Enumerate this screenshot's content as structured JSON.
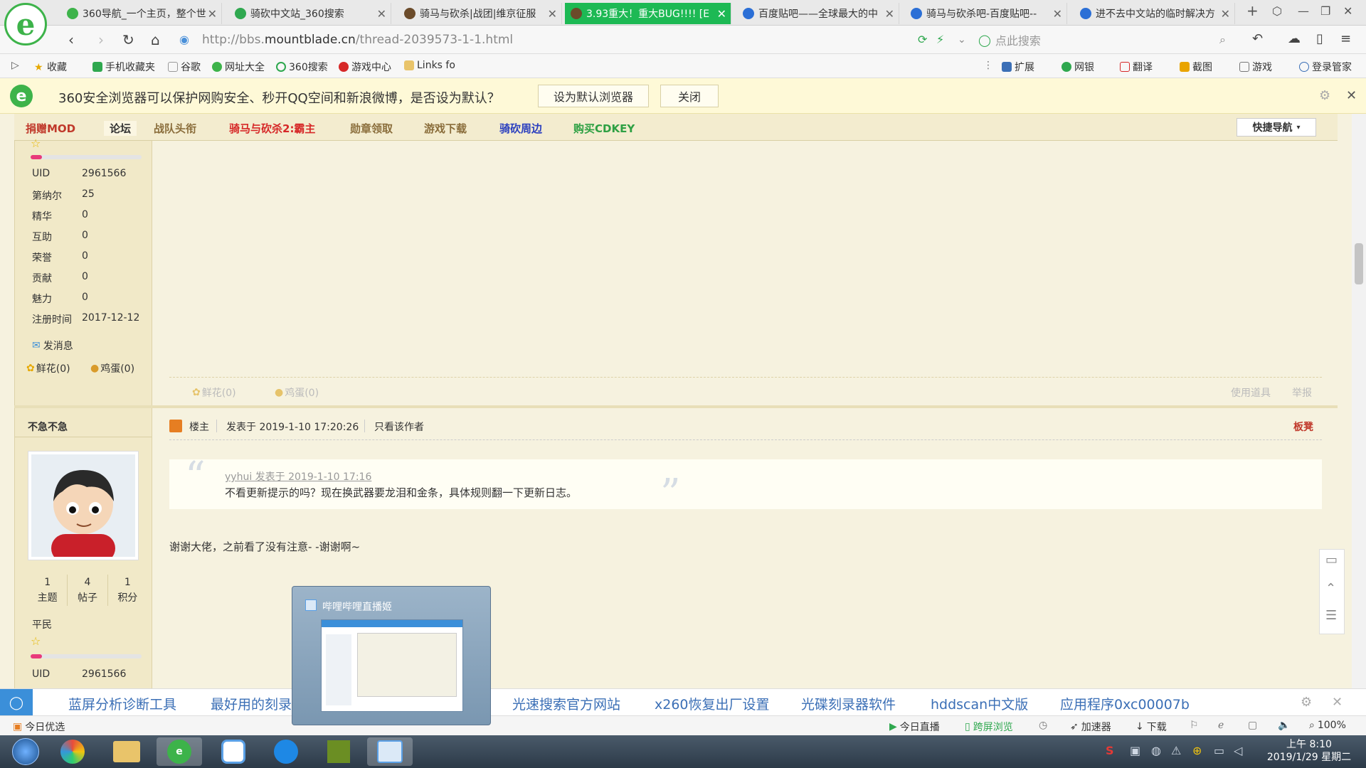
{
  "tabs": [
    {
      "label": "360导航_一个主页，整个世",
      "active": false,
      "icon_color": "#3db34a"
    },
    {
      "label": "骑砍中文站_360搜索",
      "active": false,
      "icon_color": "#2fa84f"
    },
    {
      "label": "骑马与砍杀|战团|维京征服",
      "active": false,
      "icon_color": "#6b4b2a"
    },
    {
      "label": "3.93重大！重大BUG!!!! [E",
      "active": true,
      "icon_color": "#6b4b2a"
    },
    {
      "label": "百度贴吧——全球最大的中",
      "active": false,
      "icon_color": "#2b6fd6"
    },
    {
      "label": "骑马与砍杀吧-百度贴吧--",
      "active": false,
      "icon_color": "#2b6fd6"
    },
    {
      "label": "进不去中文站的临时解决方",
      "active": false,
      "icon_color": "#2b6fd6"
    }
  ],
  "address": {
    "prefix": "http://bbs.",
    "domain": "mountblade.cn",
    "path": "/thread-2039573-1-1.html"
  },
  "search_placeholder": "点此搜索",
  "bookmarks": [
    "收藏",
    "手机收藏夹",
    "谷歌",
    "网址大全",
    "360搜索",
    "游戏中心",
    "Links fo"
  ],
  "toolbar_right": [
    "扩展",
    "网银",
    "翻译",
    "截图",
    "游戏",
    "登录管家"
  ],
  "notice": {
    "text": "360安全浏览器可以保护网购安全、秒开QQ空间和新浪微博，是否设为默认？",
    "set_default": "设为默认浏览器",
    "close": "关闭"
  },
  "forum_nav": [
    {
      "label": "捐赠MOD",
      "color": "#c0392b"
    },
    {
      "label": "论坛",
      "color": "#333333"
    },
    {
      "label": "战队头衔",
      "color": "#8a6d3b"
    },
    {
      "label": "骑马与砍杀2:霸主",
      "color": "#d62828"
    },
    {
      "label": "勋章领取",
      "color": "#8a6d3b"
    },
    {
      "label": "游戏下载",
      "color": "#8a6d3b"
    },
    {
      "label": "骑砍周边",
      "color": "#2b3fbf"
    },
    {
      "label": "购买CDKEY",
      "color": "#2ea043"
    }
  ],
  "quick_nav": "快捷导航",
  "user_top": {
    "stats": [
      {
        "label": "UID",
        "value": "2961566"
      },
      {
        "label": "第纳尔",
        "value": "25"
      },
      {
        "label": "精华",
        "value": "0"
      },
      {
        "label": "互助",
        "value": "0"
      },
      {
        "label": "荣誉",
        "value": "0"
      },
      {
        "label": "贡献",
        "value": "0"
      },
      {
        "label": "魅力",
        "value": "0"
      },
      {
        "label": "注册时间",
        "value": "2017-12-12"
      }
    ],
    "send_msg": "发消息",
    "flowers": "鲜花(0)",
    "eggs": "鸡蛋(0)"
  },
  "post1_footer": {
    "flowers": "鲜花(0)",
    "eggs": "鸡蛋(0)",
    "use_tool": "使用道具",
    "report": "举报"
  },
  "user2": {
    "name": "不急不急",
    "counts": [
      {
        "value": "1",
        "label": "主题"
      },
      {
        "value": "4",
        "label": "帖子"
      },
      {
        "value": "1",
        "label": "积分"
      }
    ],
    "rank": "平民",
    "uid_label": "UID",
    "uid": "2961566"
  },
  "post2": {
    "owner_label": "楼主",
    "posted_at": "发表于 2019-1-10 17:20:26",
    "only_author": "只看该作者",
    "floor": "板凳",
    "quote_meta": "yyhui 发表于 2019-1-10 17:16",
    "quote_text": "不看更新提示的吗？现在换武器要龙泪和金条，具体规则翻一下更新日志。",
    "body": "谢谢大佬，之前看了没有注意- -谢谢啊~"
  },
  "bottom_links": [
    "蓝屏分析诊断工具",
    "最好用的刻录",
    "光速搜索官方网站",
    "x260恢复出厂设置",
    "光碟刻录器软件",
    "hddscan中文版",
    "应用程序0xc00007b"
  ],
  "status_bar": {
    "left": "今日优选",
    "live": "今日直播",
    "screen": "跨屏浏览",
    "accel": "加速器",
    "download": "下载",
    "zoom": "100%"
  },
  "preview_title": "哔哩哔哩直播姬",
  "clock": {
    "time": "上午 8:10",
    "date": "2019/1/29 星期二"
  }
}
